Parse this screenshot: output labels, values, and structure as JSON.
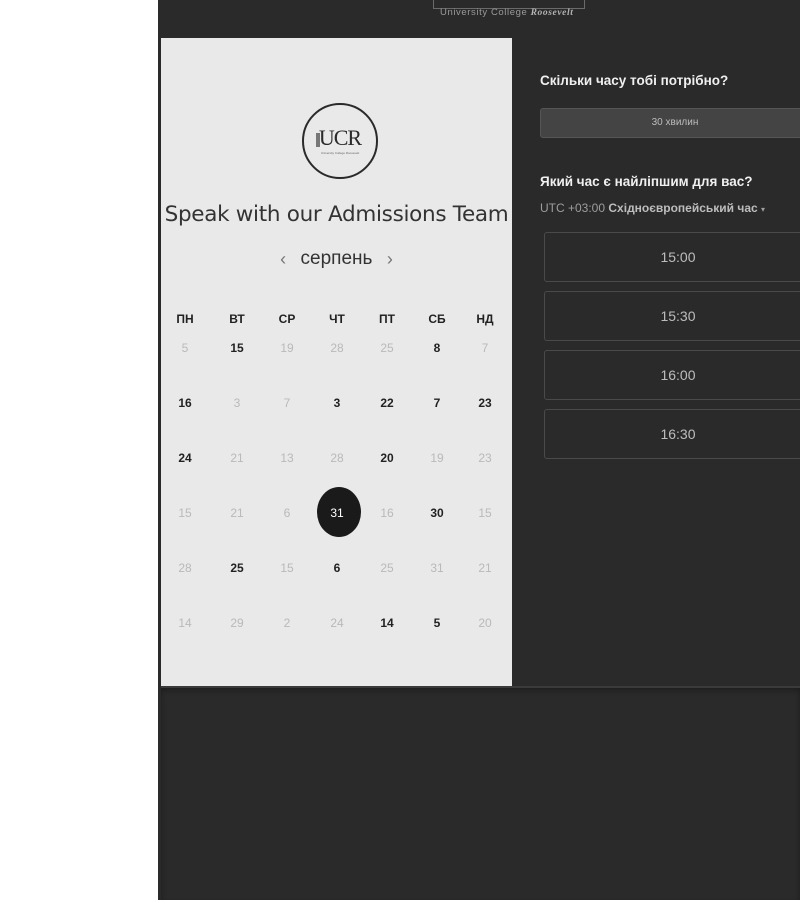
{
  "header": {
    "brand_sub_prefix": "University College ",
    "brand_sub_name": "Roosevelt"
  },
  "left_panel": {
    "logo_text": "UCR",
    "logo_tagline": "University College Roosevelt",
    "heading": "Speak with our Admissions Team",
    "month": "серпень",
    "prev_icon": "chevron-left-icon",
    "next_icon": "chevron-right-icon",
    "weekdays": [
      "ПН",
      "ВТ",
      "СР",
      "ЧТ",
      "ПТ",
      "СБ",
      "НД"
    ],
    "weeks": [
      [
        {
          "d": "5",
          "a": false
        },
        {
          "d": "15",
          "a": true
        },
        {
          "d": "19",
          "a": false
        },
        {
          "d": "28",
          "a": false
        },
        {
          "d": "25",
          "a": false
        },
        {
          "d": "8",
          "a": true
        },
        {
          "d": "7",
          "a": false
        }
      ],
      [
        {
          "d": "16",
          "a": true
        },
        {
          "d": "3",
          "a": false
        },
        {
          "d": "7",
          "a": false
        },
        {
          "d": "3",
          "a": true
        },
        {
          "d": "22",
          "a": true
        },
        {
          "d": "7",
          "a": true
        },
        {
          "d": "23",
          "a": true
        }
      ],
      [
        {
          "d": "24",
          "a": true
        },
        {
          "d": "21",
          "a": false
        },
        {
          "d": "13",
          "a": false
        },
        {
          "d": "28",
          "a": false
        },
        {
          "d": "20",
          "a": true
        },
        {
          "d": "19",
          "a": false
        },
        {
          "d": "23",
          "a": false
        }
      ],
      [
        {
          "d": "15",
          "a": false
        },
        {
          "d": "21",
          "a": false
        },
        {
          "d": "6",
          "a": false
        },
        {
          "d": "31",
          "a": true,
          "sel": true
        },
        {
          "d": "16",
          "a": false
        },
        {
          "d": "30",
          "a": true
        },
        {
          "d": "15",
          "a": false
        }
      ],
      [
        {
          "d": "28",
          "a": false
        },
        {
          "d": "25",
          "a": true
        },
        {
          "d": "15",
          "a": false
        },
        {
          "d": "6",
          "a": true
        },
        {
          "d": "25",
          "a": false
        },
        {
          "d": "31",
          "a": false
        },
        {
          "d": "21",
          "a": false
        }
      ],
      [
        {
          "d": "14",
          "a": false
        },
        {
          "d": "29",
          "a": false
        },
        {
          "d": "2",
          "a": false
        },
        {
          "d": "24",
          "a": false
        },
        {
          "d": "14",
          "a": true
        },
        {
          "d": "5",
          "a": true
        },
        {
          "d": "20",
          "a": false
        }
      ]
    ]
  },
  "right_panel": {
    "duration_question": "Скільки часу тобі потрібно?",
    "duration_value": "30 хвилин",
    "time_question": "Який час є найліпшим для вас?",
    "tz_offset": "UTC +03:00",
    "tz_name": "Східноєвропейський час",
    "tz_caret": "▾",
    "slots": [
      "15:00",
      "15:30",
      "16:00",
      "16:30"
    ]
  },
  "colors": {
    "dark_bg": "#2a2a2a",
    "calendar_bg": "#e9e9e9",
    "selected_day": "#1a1a1a"
  }
}
